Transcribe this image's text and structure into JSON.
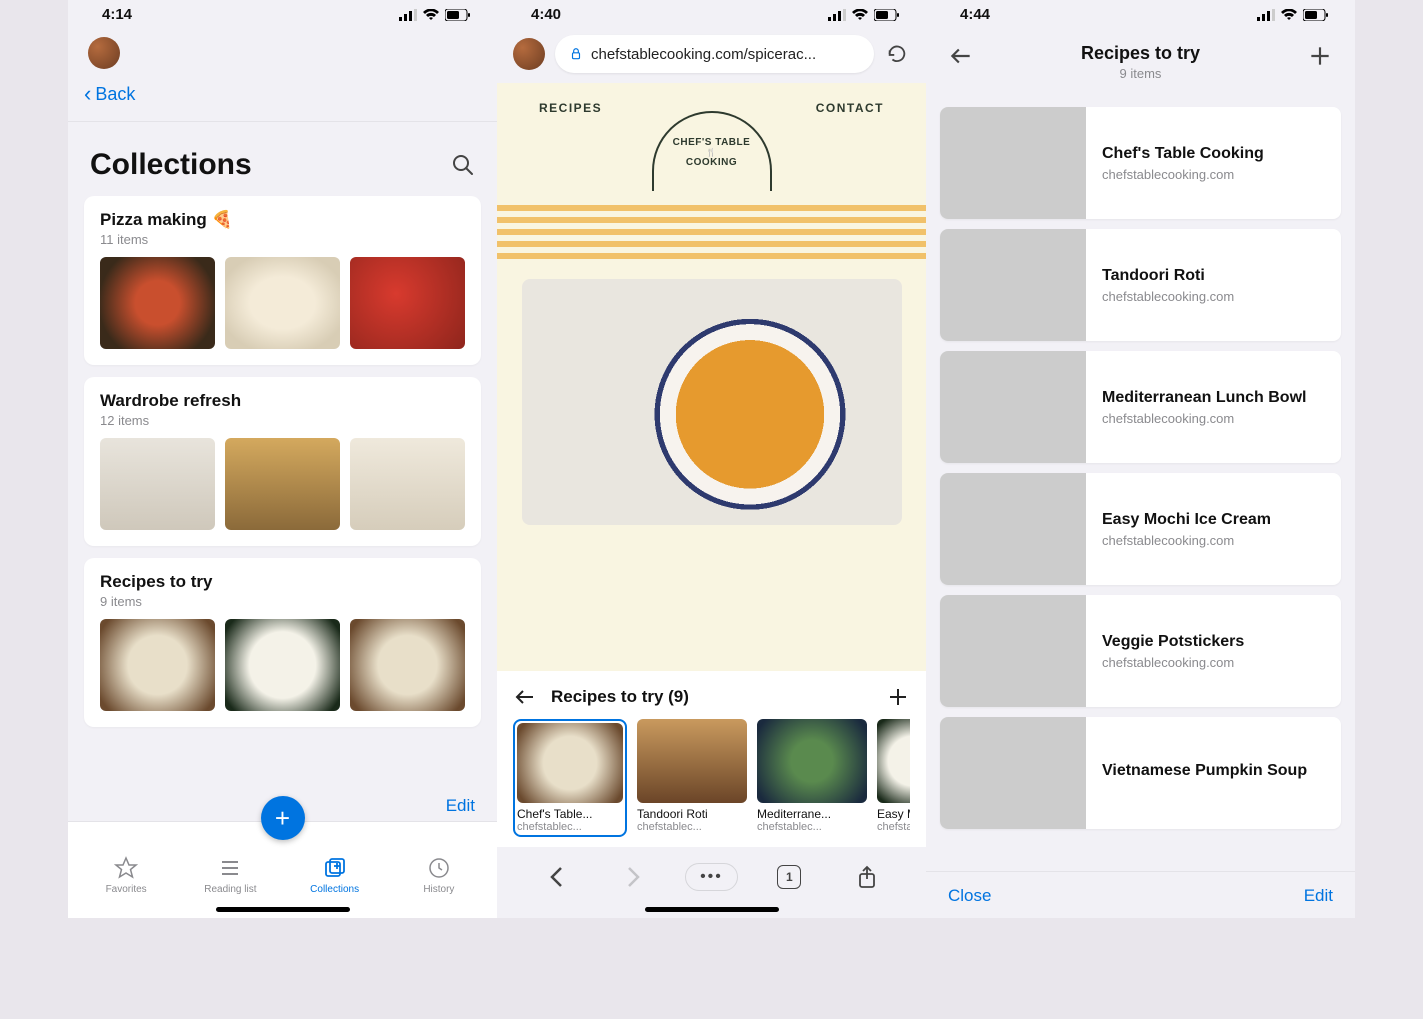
{
  "screen1": {
    "time": "4:14",
    "back_label": "Back",
    "title": "Collections",
    "cards": [
      {
        "title": "Pizza making 🍕",
        "sub": "11 items"
      },
      {
        "title": "Wardrobe refresh",
        "sub": "12 items"
      },
      {
        "title": "Recipes to try",
        "sub": "9 items"
      }
    ],
    "edit": "Edit",
    "tabs": {
      "favorites": "Favorites",
      "reading": "Reading list",
      "collections": "Collections",
      "history": "History"
    }
  },
  "screen2": {
    "time": "4:40",
    "url": "chefstablecooking.com/spicerac...",
    "web": {
      "nav_left": "RECIPES",
      "nav_right": "CONTACT",
      "brand_top": "CHEF'S TABLE",
      "brand_bottom": "COOKING"
    },
    "drawer_title": "Recipes to try  (9)",
    "items": [
      {
        "title": "Chef's Table...",
        "sub": "chefstablec..."
      },
      {
        "title": "Tandoori Roti",
        "sub": "chefstablec..."
      },
      {
        "title": "Mediterrane...",
        "sub": "chefstablec..."
      },
      {
        "title": "Easy Moc",
        "sub": "chefstabl"
      }
    ],
    "tab_count": "1"
  },
  "screen3": {
    "time": "4:44",
    "title": "Recipes to try",
    "sub": "9 items",
    "rows": [
      {
        "title": "Chef's Table Cooking",
        "sub": "chefstablecooking.com",
        "img": "f-dumpling"
      },
      {
        "title": "Tandoori Roti",
        "sub": "chefstablecooking.com",
        "img": "f-roti"
      },
      {
        "title": "Mediterranean Lunch Bowl",
        "sub": "chefstablecooking.com",
        "img": "f-bowl"
      },
      {
        "title": "Easy Mochi Ice Cream",
        "sub": "chefstablecooking.com",
        "img": "f-mochi"
      },
      {
        "title": "Veggie Potstickers",
        "sub": "chefstablecooking.com",
        "img": "f-dumpling"
      },
      {
        "title": "Vietnamese Pumpkin Soup",
        "sub": "",
        "img": "f-soup"
      }
    ],
    "close": "Close",
    "edit": "Edit"
  }
}
